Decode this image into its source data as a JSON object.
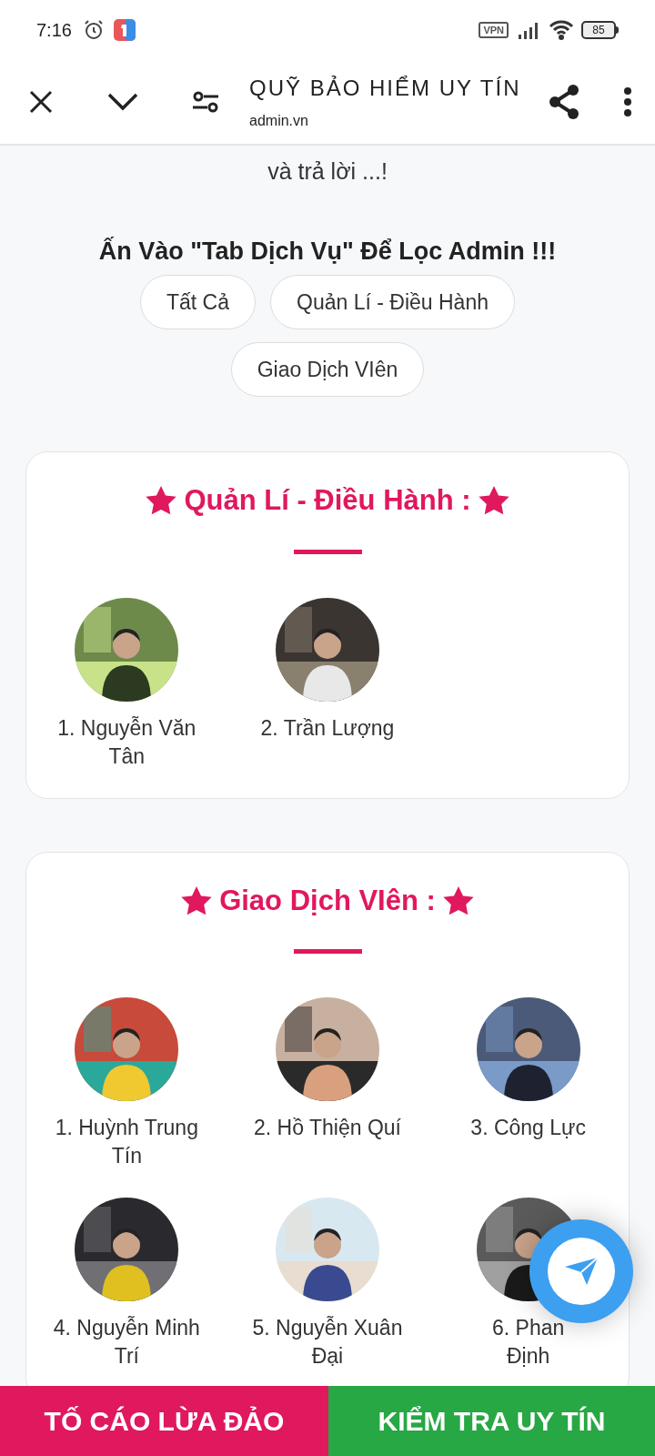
{
  "status_bar": {
    "time": "7:16",
    "vpn": "VPN",
    "battery": "85"
  },
  "app_bar": {
    "title": "QUỸ BẢO HIỂM UY TÍN",
    "url": "admin.vn"
  },
  "intro_tail": "và trả lời ...!",
  "filter_heading": "Ấn Vào \"Tab Dịch Vụ\" Để Lọc Admin !!!",
  "filters": [
    {
      "label": "Tất Cả",
      "selected": false
    },
    {
      "label": "Quản Lí - Điều Hành",
      "selected": false
    },
    {
      "label": "Giao Dịch VIên",
      "selected": false
    }
  ],
  "sections": [
    {
      "title": "Quản Lí - Điều Hành :",
      "members": [
        {
          "name": "1. Nguyễn Văn Tân"
        },
        {
          "name": "2. Trần Lượng"
        }
      ]
    },
    {
      "title": "Giao Dịch VIên :",
      "members": [
        {
          "name": "1. Huỳnh Trung Tín"
        },
        {
          "name": "2. Hồ Thiện Quí"
        },
        {
          "name": "3. Công Lực"
        },
        {
          "name": "4. Nguyễn Minh Trí"
        },
        {
          "name": "5. Nguyễn Xuân Đại"
        },
        {
          "name": "6. Phan\nĐịnh"
        }
      ]
    }
  ],
  "bottom_buttons": [
    {
      "label": "TỐ CÁO LỪA ĐẢO",
      "kind": "report"
    },
    {
      "label": "KIỂM TRA UY TÍN",
      "kind": "check"
    }
  ]
}
